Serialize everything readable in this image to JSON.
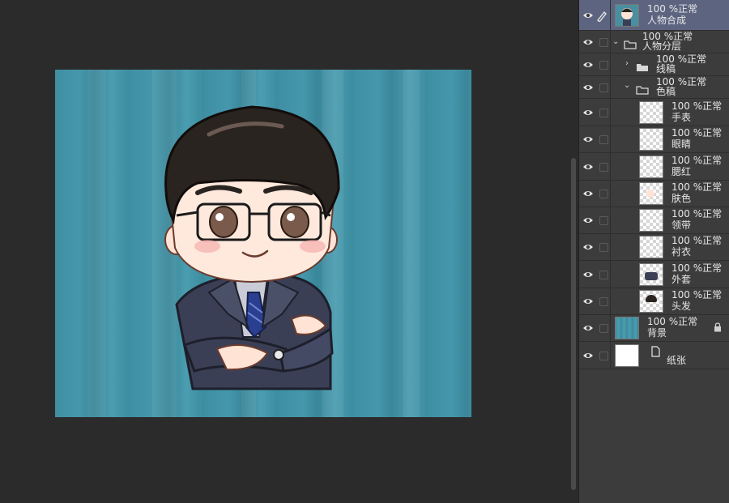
{
  "layers": [
    {
      "id": "char-comp",
      "opacity": "100 %正常",
      "name": "人物合成",
      "selected": true
    },
    {
      "id": "char-layers",
      "opacity": "100 %正常",
      "name": "人物分层"
    },
    {
      "id": "lineart",
      "opacity": "100 %正常",
      "name": "线稿"
    },
    {
      "id": "color",
      "opacity": "100 %正常",
      "name": "色稿"
    },
    {
      "id": "watch",
      "opacity": "100 %正常",
      "name": "手表"
    },
    {
      "id": "eyes",
      "opacity": "100 %正常",
      "name": "眼睛"
    },
    {
      "id": "blush",
      "opacity": "100 %正常",
      "name": "腮红"
    },
    {
      "id": "skin",
      "opacity": "100 %正常",
      "name": "肤色"
    },
    {
      "id": "tie",
      "opacity": "100 %正常",
      "name": "领带"
    },
    {
      "id": "shirt",
      "opacity": "100 %正常",
      "name": "衬衣"
    },
    {
      "id": "jacket",
      "opacity": "100 %正常",
      "name": "外套"
    },
    {
      "id": "hair",
      "opacity": "100 %正常",
      "name": "头发"
    },
    {
      "id": "bg",
      "opacity": "100 %正常",
      "name": "背景"
    },
    {
      "id": "paper",
      "name": "纸张"
    }
  ],
  "colors": {
    "selected": "#5c6480",
    "panel": "#3c3c3c",
    "canvas_bg": "#2b2b2b",
    "artwork_teal": "#4597ab"
  },
  "icons": [
    "eye-icon",
    "pen-icon",
    "folder-icon",
    "chevron-right-icon",
    "chevron-down-icon",
    "lock-icon",
    "paper-icon"
  ]
}
